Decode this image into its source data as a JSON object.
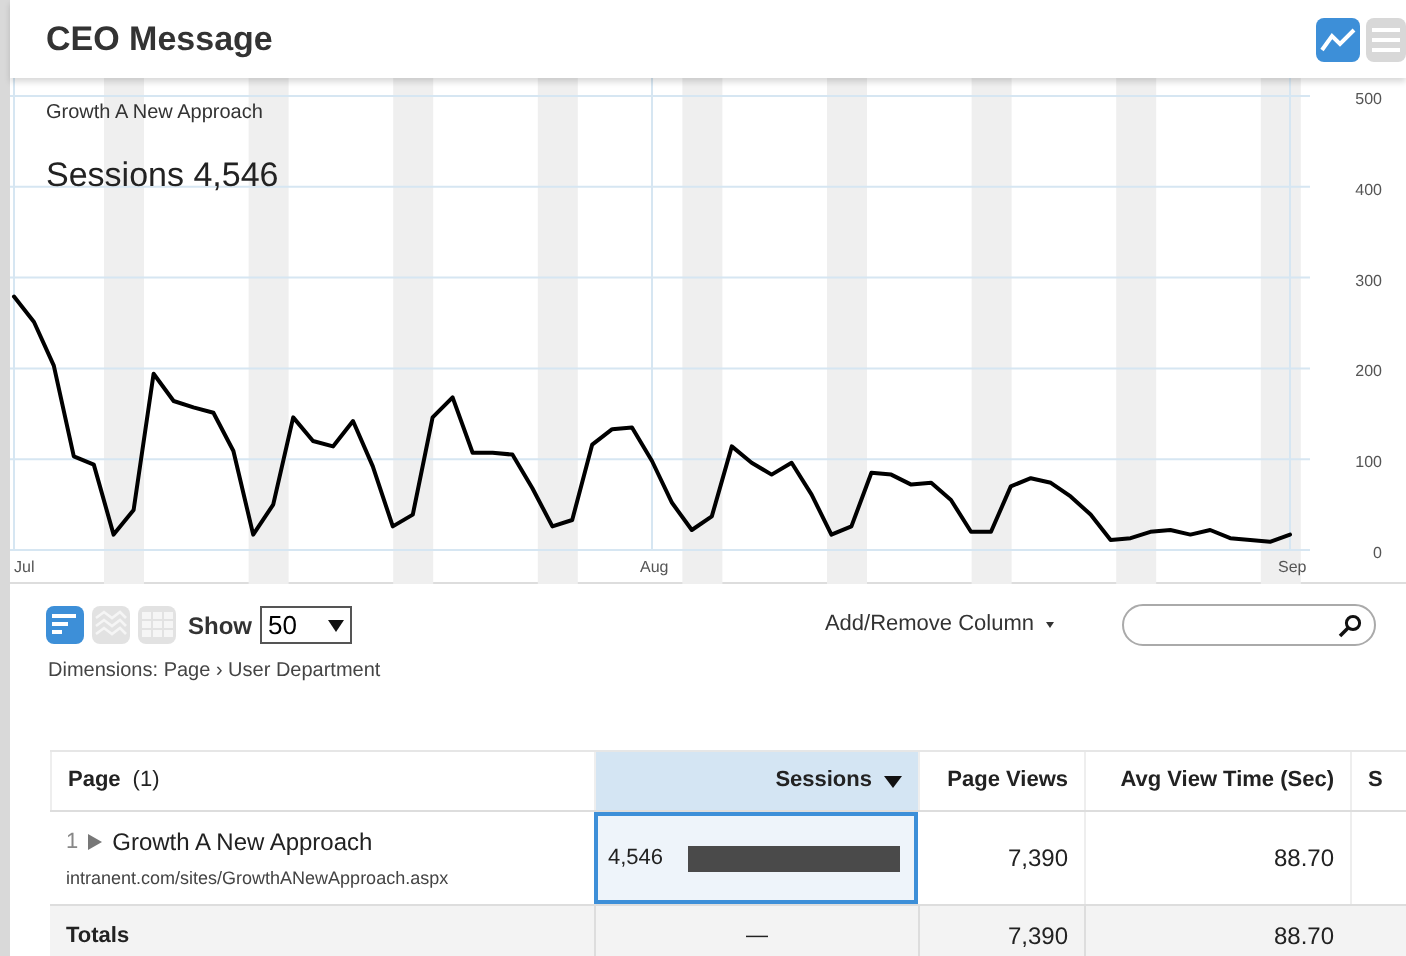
{
  "header": {
    "title": "CEO Message",
    "views": [
      {
        "kind": "chart",
        "selected": true
      },
      {
        "kind": "list",
        "selected": false
      }
    ]
  },
  "chart": {
    "subtitle": "Growth A New Approach",
    "metric_value": "4,546",
    "chart_data": {
      "type": "line",
      "grid": true,
      "ylim": [
        0,
        500
      ],
      "yticks": [
        0,
        100,
        200,
        300,
        400,
        500
      ],
      "categories": [
        "Jul",
        null,
        null,
        null,
        null,
        null,
        null,
        null,
        null,
        null,
        null,
        null,
        null,
        null,
        null,
        null,
        null,
        null,
        null,
        null,
        null,
        null,
        null,
        null,
        null,
        null,
        null,
        null,
        null,
        null,
        null,
        null,
        "Aug",
        null,
        null,
        null,
        null,
        null,
        null,
        null,
        null,
        null,
        null,
        null,
        null,
        null,
        null,
        null,
        null,
        null,
        null,
        null,
        null,
        null,
        null,
        null,
        null,
        null,
        null,
        null,
        null,
        null,
        null,
        null,
        "Sep"
      ],
      "series": [
        {
          "name": "Sessions",
          "color": "#000000",
          "values": [
            279,
            251,
            203,
            103,
            94,
            17,
            44,
            194,
            164,
            157,
            151,
            109,
            17,
            50,
            146,
            120,
            114,
            142,
            92,
            26,
            39,
            146,
            168,
            107,
            107,
            105,
            68,
            26,
            33,
            116,
            133,
            135,
            98,
            52,
            22,
            37,
            114,
            96,
            83,
            96,
            61,
            17,
            26,
            85,
            83,
            72,
            74,
            55,
            20,
            20,
            70,
            79,
            74,
            59,
            39,
            11,
            13,
            20,
            22,
            17,
            22,
            13,
            11,
            9,
            17
          ]
        }
      ]
    }
  },
  "toolbar": {
    "view_modes": [
      {
        "kind": "bars",
        "selected": true
      },
      {
        "kind": "wave",
        "selected": false
      },
      {
        "kind": "grid",
        "selected": false
      }
    ],
    "show_label": "Show",
    "show_value": "50",
    "add_remove": "Add/Remove Column"
  },
  "dimensions": {
    "label": "Dimensions:",
    "path": "Page › User Department"
  },
  "table": {
    "columns": [
      {
        "label": "Page",
        "count": "(1)",
        "selected": false
      },
      {
        "label": "Sessions",
        "selected": true
      },
      {
        "label": "Page Views",
        "selected": false
      },
      {
        "label": "Avg View Time (Sec)",
        "selected": false
      },
      {
        "label": "S",
        "selected": false
      }
    ],
    "rows": [
      {
        "index": "1",
        "title": "Growth A New Approach",
        "url": "intranent.com/sites/GrowthANewApproach.aspx",
        "sessions": "4,546",
        "level": 1,
        "page_views": "7,390",
        "avg_time": "88.70"
      }
    ],
    "totals": {
      "label": "Totals",
      "sessions": "—",
      "page_views": "7,390",
      "avg_time": "88.70"
    }
  }
}
